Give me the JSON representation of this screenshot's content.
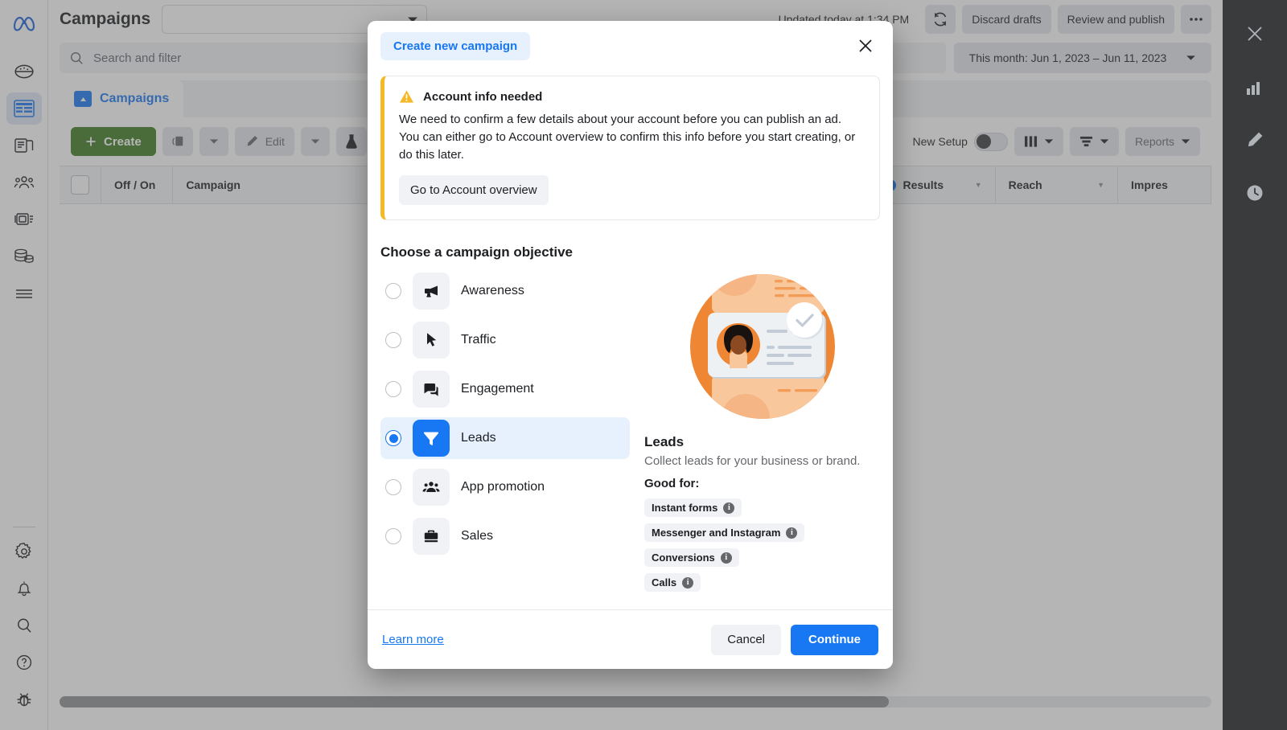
{
  "app": {
    "page_title": "Campaigns",
    "updated_text": "Updated today at 1:34 PM",
    "top_buttons": {
      "refresh_icon": "refresh-icon",
      "discard_drafts": "Discard drafts",
      "review_and_publish": "Review and publish",
      "more_icon": "more-horizontal-icon"
    },
    "search": {
      "placeholder": "Search and filter",
      "icon": "search-icon"
    },
    "date_range": "This month: Jun 1, 2023 – Jun 11, 2023",
    "tab": {
      "label": "Campaigns",
      "icon": "folder-icon"
    },
    "toolbar": {
      "create": "Create",
      "duplicate_icon": "duplicate-icon",
      "edit": "Edit",
      "ab_test_icon": "ab-test-flask-icon",
      "new_setup_label": "New Setup",
      "columns_icon": "columns-icon",
      "breakdown_icon": "breakdown-icon",
      "reports": "Reports"
    },
    "table_headers": [
      "Off / On",
      "Campaign",
      "Results",
      "Reach",
      "Impres"
    ],
    "left_rail_icons": [
      "meta-logo",
      "dashboard-icon",
      "table-icon",
      "pages-icon",
      "audience-icon",
      "ad-account-icon",
      "billing-icon",
      "menu-icon",
      "gear-icon",
      "bell-icon",
      "search-icon",
      "help-icon",
      "bug-icon"
    ],
    "right_rail_icons": [
      "close-icon",
      "bar-chart-icon",
      "pencil-icon",
      "clock-icon"
    ]
  },
  "modal": {
    "header_pill": "Create new campaign",
    "close_icon": "close-icon",
    "alert": {
      "icon": "warning-triangle-icon",
      "title": "Account info needed",
      "body": "We need to confirm a few details about your account before you can publish an ad. You can either go to Account overview to confirm this info before you start creating, or do this later.",
      "button": "Go to Account overview"
    },
    "section_title": "Choose a campaign objective",
    "objectives": [
      {
        "label": "Awareness",
        "icon": "megaphone-icon",
        "selected": false
      },
      {
        "label": "Traffic",
        "icon": "cursor-icon",
        "selected": false
      },
      {
        "label": "Engagement",
        "icon": "chat-bubbles-icon",
        "selected": false
      },
      {
        "label": "Leads",
        "icon": "funnel-icon",
        "selected": true
      },
      {
        "label": "App promotion",
        "icon": "people-icon",
        "selected": false
      },
      {
        "label": "Sales",
        "icon": "briefcase-icon",
        "selected": false
      }
    ],
    "detail": {
      "illustration": "lead-contact-card-illustration",
      "title": "Leads",
      "subtitle": "Collect leads for your business or brand.",
      "good_for_label": "Good for:",
      "tags": [
        "Instant forms",
        "Messenger and Instagram",
        "Conversions",
        "Calls"
      ]
    },
    "footer": {
      "learn_more": "Learn more",
      "cancel": "Cancel",
      "continue": "Continue"
    }
  },
  "colors": {
    "brand_blue": "#1877f2",
    "create_green": "#3d7b21",
    "warning_yellow": "#f5b928",
    "illustration_orange": "#ef8633",
    "rail_dark": "#3a3b3c"
  }
}
